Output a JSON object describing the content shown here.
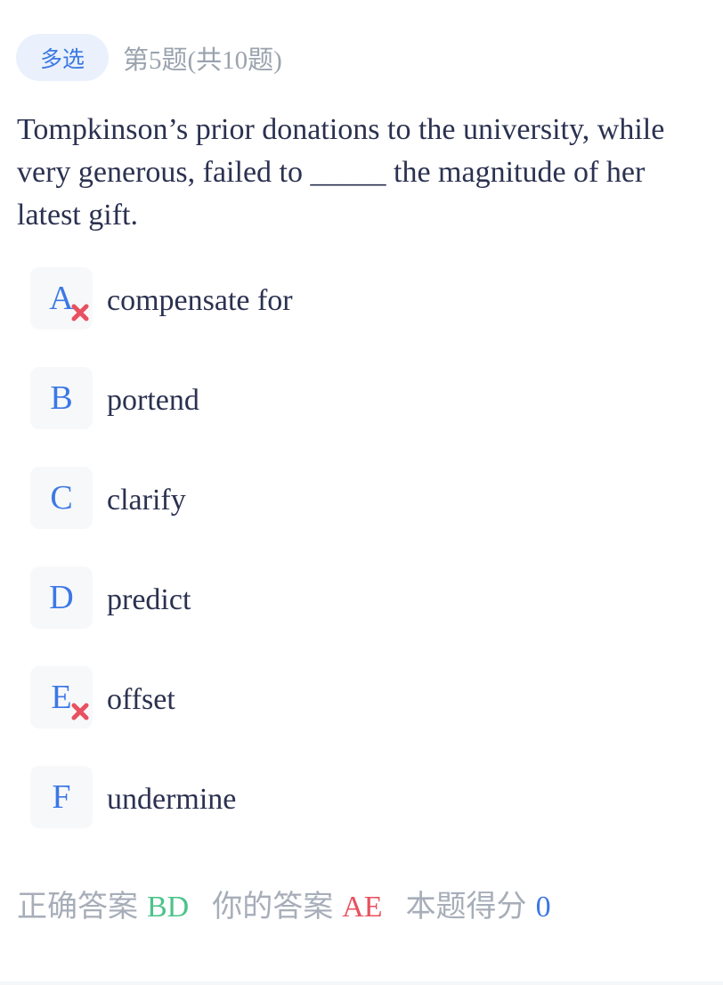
{
  "header": {
    "type_label": "多选",
    "progress_text": "第5题(共10题)"
  },
  "question": {
    "text": "Tompkinson’s prior donations to the university, while very generous, failed to _____ the magnitude of her latest gift."
  },
  "options": [
    {
      "letter": "A",
      "text": "compensate for",
      "wrong": true
    },
    {
      "letter": "B",
      "text": "portend",
      "wrong": false
    },
    {
      "letter": "C",
      "text": "clarify",
      "wrong": false
    },
    {
      "letter": "D",
      "text": "predict",
      "wrong": false
    },
    {
      "letter": "E",
      "text": "offset",
      "wrong": true
    },
    {
      "letter": "F",
      "text": "undermine",
      "wrong": false
    }
  ],
  "summary": {
    "correct_label": "正确答案",
    "correct_value": "BD",
    "yours_label": "你的答案",
    "yours_value": "AE",
    "score_label": "本题得分",
    "score_value": "0"
  },
  "colors": {
    "accent": "#3b78e3",
    "correct": "#4cc38a",
    "wrong": "#e8515f",
    "muted": "#9aa3ae"
  },
  "icons": {
    "wrong_mark": "close-icon"
  }
}
